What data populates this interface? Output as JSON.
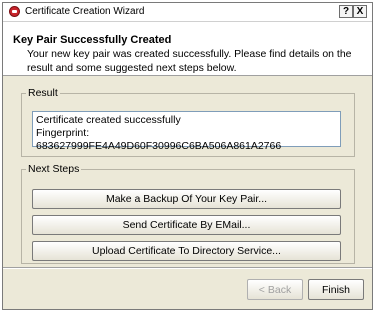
{
  "window": {
    "title": "Certificate Creation Wizard",
    "help_label": "?",
    "close_label": "X"
  },
  "header": {
    "title": "Key Pair Successfully Created",
    "description": "Your new key pair was created successfully. Please find details on the result and some suggested next steps below."
  },
  "result": {
    "legend": "Result",
    "line1": "Certificate created successfully",
    "line2": "Fingerprint: 683627999FE4A49D60F30996C6BA506A861A2766"
  },
  "next_steps": {
    "legend": "Next Steps",
    "backup_label": "Make a Backup Of Your Key Pair...",
    "email_label": "Send Certificate By EMail...",
    "upload_label": "Upload Certificate To Directory Service..."
  },
  "footer": {
    "back_label": "< Back",
    "finish_label": "Finish"
  }
}
